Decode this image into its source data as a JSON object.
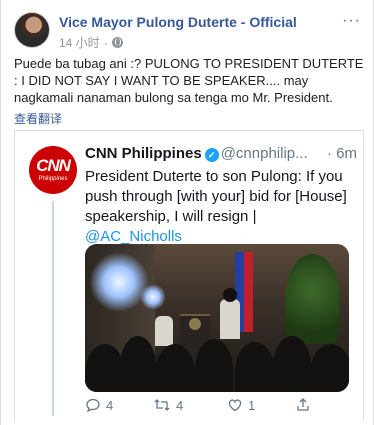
{
  "post": {
    "page_name": "Vice Mayor Pulong Duterte - Official",
    "time": "14 小时",
    "more_label": "···",
    "text": "Puede ba tubag ani :? PULONG TO PRESIDENT DUTERTE : I DID NOT SAY I WANT TO BE SPEAKER.... may nagkamali nanaman bulong sa tenga mo Mr. President.",
    "translate_label": "查看翻译"
  },
  "tweet": {
    "logo_text": "CNN",
    "logo_subtext": "Philippines",
    "author_name": "CNN Philippines",
    "verified_mark": "✓",
    "handle": "@cnnphilip...",
    "time": "· 6m",
    "text": "President Duterte to son Pulong: If you push through [with your] bid for [House] speakership, I will resign | ",
    "mention": "@AC_Nicholls",
    "actions": {
      "reply_count": "4",
      "retweet_count": "4",
      "like_count": "1",
      "share_count": ""
    }
  },
  "colors": {
    "link_blue": "#365899",
    "twitter_blue": "#1da1f2",
    "cnn_red": "#cc0000",
    "muted": "#90949c"
  },
  "icons": [
    "globe-icon",
    "more-icon",
    "verified-icon",
    "reply-icon",
    "retweet-icon",
    "like-icon",
    "share-icon"
  ]
}
